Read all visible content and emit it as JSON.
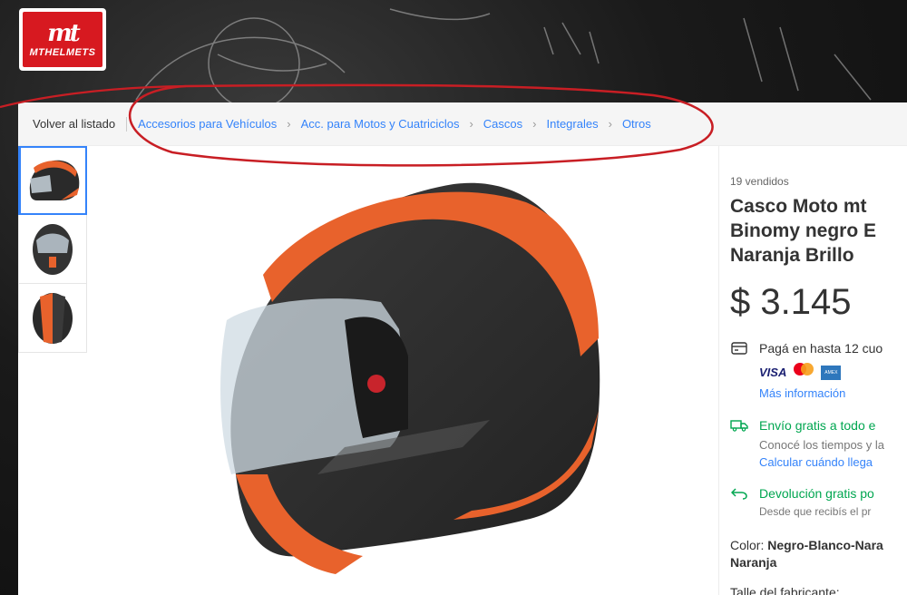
{
  "brand": {
    "logo_text": "MTHELMETS"
  },
  "breadcrumb": {
    "back_label": "Volver al listado",
    "items": [
      "Accesorios para Vehículos",
      "Acc. para Motos y Cuatriciclos",
      "Cascos",
      "Integrales",
      "Otros"
    ]
  },
  "product": {
    "sold_count": "19 vendidos",
    "title_lines": [
      "Casco Moto mt",
      "Binomy negro E",
      "Naranja Brillo"
    ],
    "price": "$ 3.145",
    "payment": {
      "text": "Pagá en hasta 12 cuo",
      "cards": [
        "VISA",
        "mastercard",
        "AMEX"
      ],
      "more_info": "Más información"
    },
    "shipping": {
      "title": "Envío gratis a todo e",
      "subtitle": "Conocé los tiempos y la",
      "link": "Calcular cuándo llega"
    },
    "returns": {
      "title": "Devolución gratis po",
      "subtitle": "Desde que recibís el pr"
    },
    "color": {
      "label": "Color: ",
      "value_line1": "Negro-Blanco-Nara",
      "value_line2": "Naranja"
    },
    "size_label": "Talle del fabricante:"
  },
  "colors": {
    "link": "#3483fa",
    "green": "#00a650",
    "annotation_red": "#c81e24",
    "brand_red": "#d71920"
  }
}
